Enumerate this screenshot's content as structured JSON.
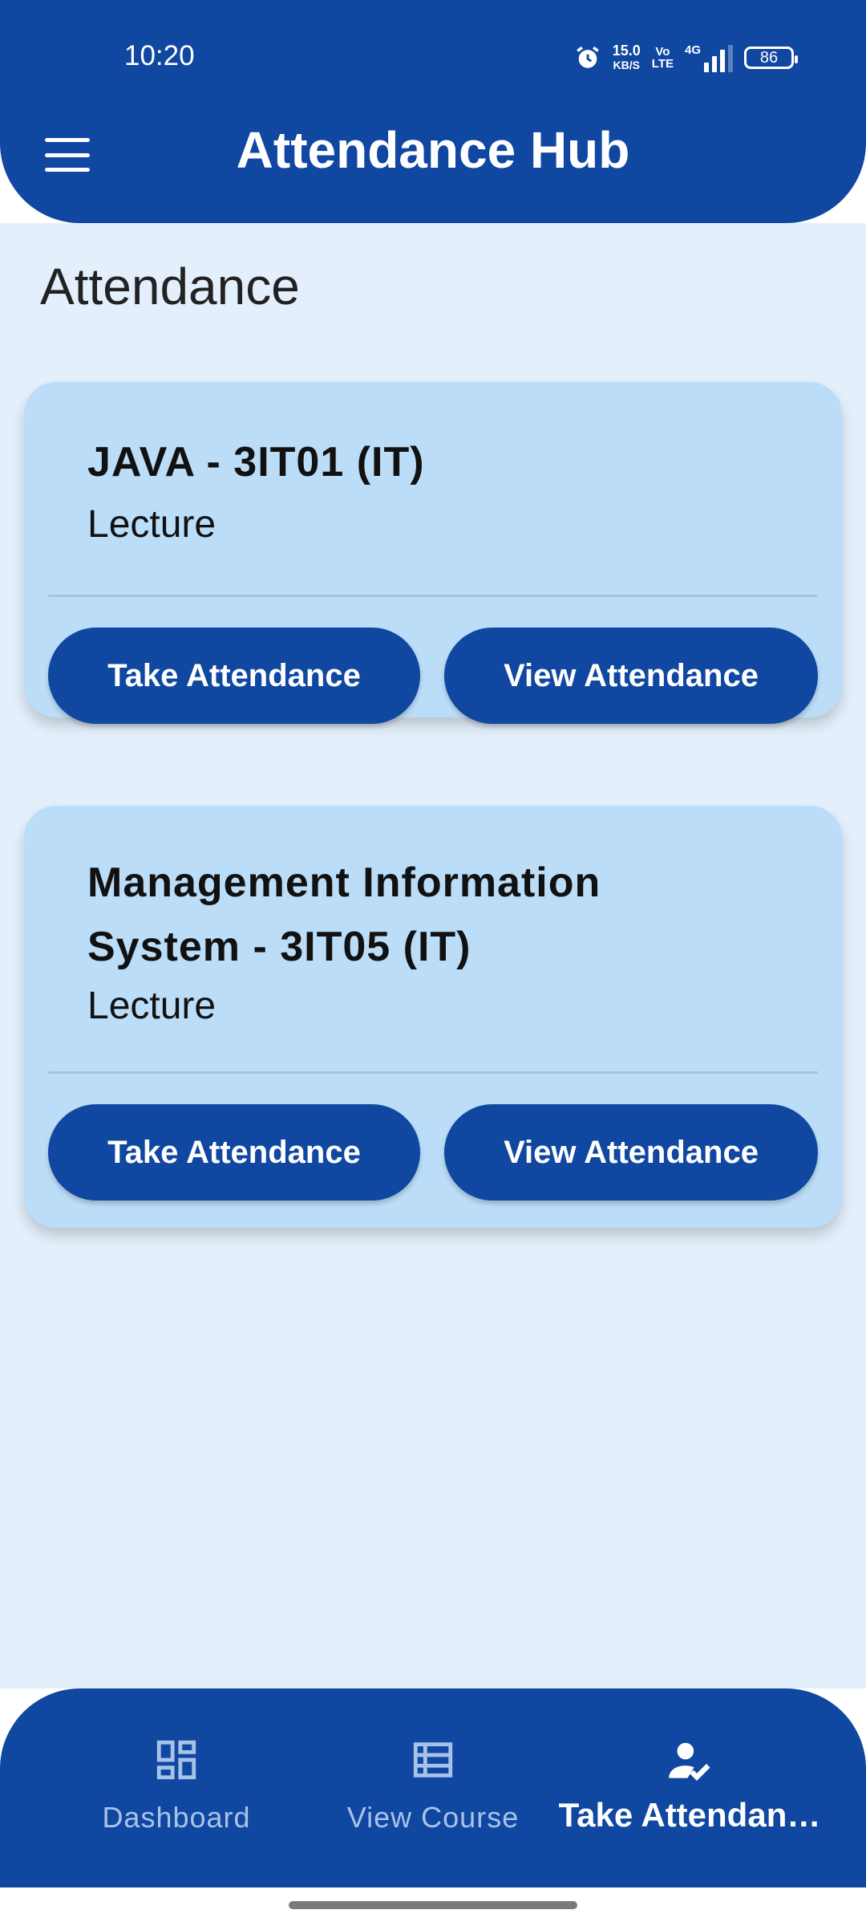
{
  "status_bar": {
    "time": "10:20",
    "net_speed": "15.0",
    "net_unit": "KB/S",
    "volte_top": "Vo",
    "volte_bottom": "LTE",
    "network": "4G",
    "battery": "86",
    "icons": [
      "alarm-icon",
      "signal-icon",
      "battery-icon"
    ]
  },
  "header": {
    "title": "Attendance Hub",
    "menu_icon": "hamburger-menu-icon"
  },
  "page": {
    "title": "Attendance"
  },
  "courses": [
    {
      "name": "JAVA - 3IT01 (IT)",
      "type": "Lecture",
      "take_label": "Take Attendance",
      "view_label": "View Attendance"
    },
    {
      "name": "Management Information System  - 3IT05 (IT)",
      "type": "Lecture",
      "take_label": "Take Attendance",
      "view_label": "View Attendance"
    }
  ],
  "bottom_nav": {
    "items": [
      {
        "label": "Dashboard",
        "icon": "dashboard-icon"
      },
      {
        "label": "View Course",
        "icon": "list-icon"
      },
      {
        "label": "Take Attendan…",
        "icon": "person-check-icon",
        "active": true
      }
    ]
  },
  "colors": {
    "primary": "#0f47a1",
    "background": "#e3f0fc",
    "card": "#bbddf8"
  }
}
